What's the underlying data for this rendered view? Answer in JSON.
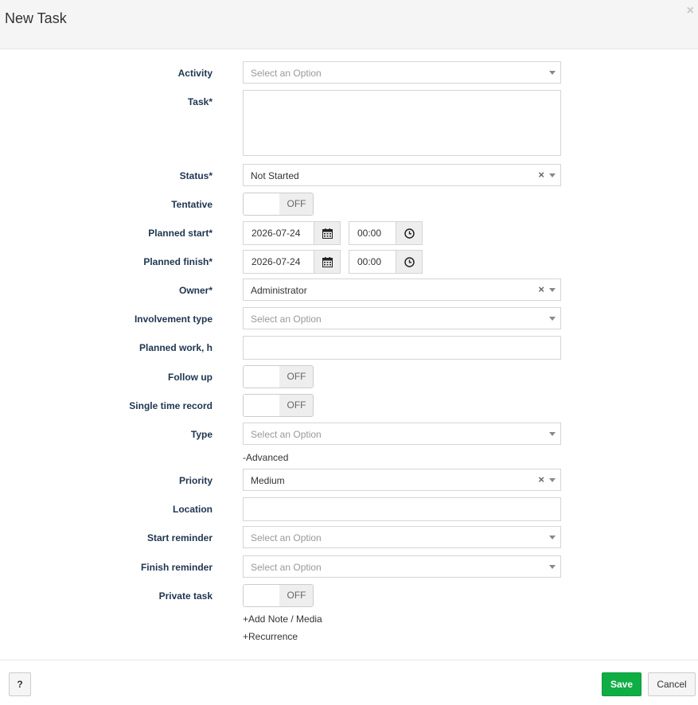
{
  "dialog": {
    "title": "New Task",
    "close_symbol": "×"
  },
  "form": {
    "activity": {
      "label": "Activity",
      "placeholder": "Select an Option"
    },
    "task": {
      "label": "Task*",
      "value": ""
    },
    "status": {
      "label": "Status*",
      "value": "Not Started"
    },
    "tentative": {
      "label": "Tentative",
      "state": "OFF"
    },
    "planned_start": {
      "label": "Planned start*",
      "date": "2026-07-24",
      "time": "00:00"
    },
    "planned_finish": {
      "label": "Planned finish*",
      "date": "2026-07-24",
      "time": "00:00"
    },
    "owner": {
      "label": "Owner*",
      "value": "Administrator"
    },
    "involvement_type": {
      "label": "Involvement type",
      "placeholder": "Select an Option"
    },
    "planned_work": {
      "label": "Planned work, h",
      "value": ""
    },
    "follow_up": {
      "label": "Follow up",
      "state": "OFF"
    },
    "single_time_record": {
      "label": "Single time record",
      "state": "OFF"
    },
    "type": {
      "label": "Type",
      "placeholder": "Select an Option"
    },
    "advanced_toggle": "-Advanced",
    "priority": {
      "label": "Priority",
      "value": "Medium"
    },
    "location": {
      "label": "Location",
      "value": ""
    },
    "start_reminder": {
      "label": "Start reminder",
      "placeholder": "Select an Option"
    },
    "finish_reminder": {
      "label": "Finish reminder",
      "placeholder": "Select an Option"
    },
    "private_task": {
      "label": "Private task",
      "state": "OFF"
    },
    "add_note_link": "+Add Note / Media",
    "recurrence_link": "+Recurrence",
    "clear_symbol": "×"
  },
  "footer": {
    "help_label": "?",
    "save_label": "Save",
    "cancel_label": "Cancel"
  },
  "colors": {
    "save_green": "#0fae45",
    "label_navy": "#1f3550",
    "header_bg": "#f5f5f5"
  },
  "icons": {
    "calendar": "calendar-icon",
    "clock": "clock-icon",
    "caret": "chevron-down-icon",
    "clear": "close-icon"
  }
}
